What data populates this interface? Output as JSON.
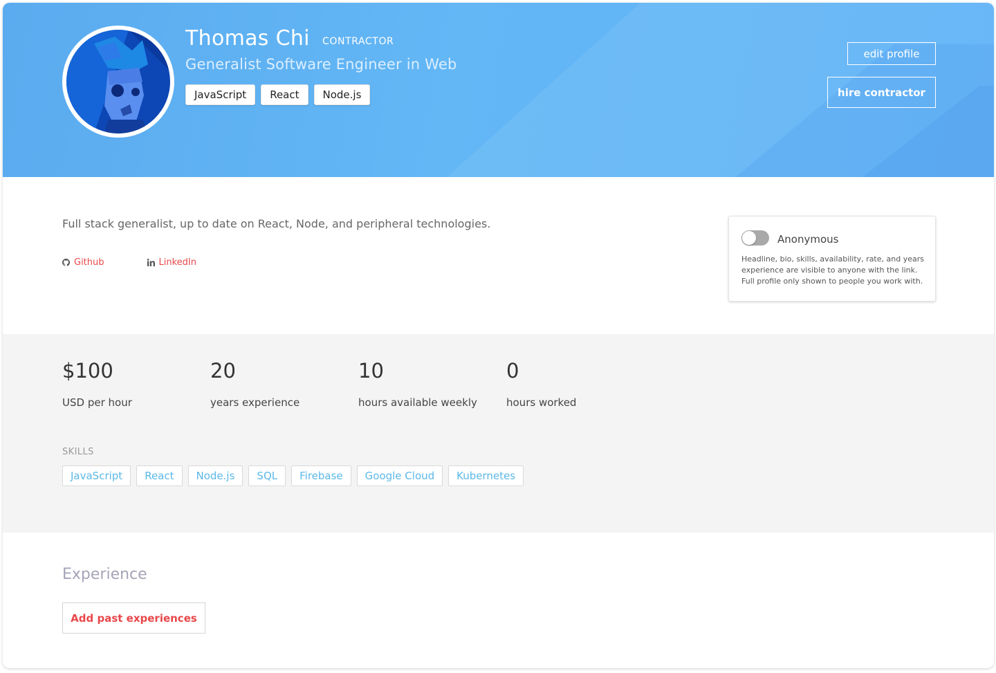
{
  "profile": {
    "name": "Thomas Chi",
    "role": "CONTRACTOR",
    "headline": "Generalist Software Engineer in Web",
    "header_tags": [
      "JavaScript",
      "React",
      "Node.js"
    ],
    "avatar_icon": "avatar-illustration-icon"
  },
  "actions": {
    "edit_label": "edit profile",
    "hire_label": "hire contractor"
  },
  "bio": {
    "text": "Full stack generalist, up to date on React, Node, and peripheral technologies.",
    "links": [
      {
        "label": "Github",
        "icon": "github-icon"
      },
      {
        "label": "LinkedIn",
        "icon": "linkedin-icon"
      }
    ]
  },
  "privacy": {
    "toggle_on": false,
    "title": "Anonymous",
    "description": "Headline, bio, skills, availability, rate, and years experience are visible to anyone with the link. Full profile only shown to people you work with."
  },
  "stats": [
    {
      "value": "$100",
      "label": "USD per hour"
    },
    {
      "value": "20",
      "label": "years experience"
    },
    {
      "value": "10",
      "label": "hours available weekly"
    },
    {
      "value": "0",
      "label": "hours worked"
    }
  ],
  "skills": {
    "title": "SKILLS",
    "items": [
      "JavaScript",
      "React",
      "Node.js",
      "SQL",
      "Firebase",
      "Google Cloud",
      "Kubernetes"
    ]
  },
  "experience": {
    "title": "Experience",
    "add_label": "Add past experiences"
  },
  "colors": {
    "header_blue": "#63b7f5",
    "link_red": "#e8474a",
    "skill_blue": "#5bb8e8"
  }
}
